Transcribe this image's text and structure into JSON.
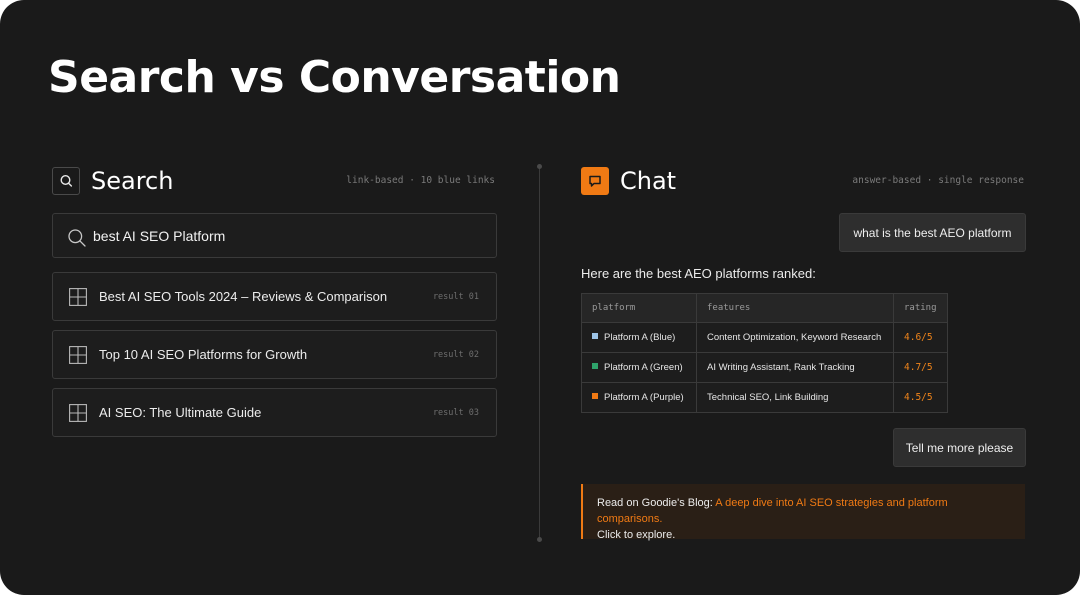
{
  "title": "Search vs Conversation",
  "search_panel": {
    "heading": "Search",
    "meta": "link-based · 10 blue links",
    "query": "best AI SEO Platform",
    "results": [
      {
        "title": "Best AI SEO Tools 2024 – Reviews & Comparison",
        "tag": "result 01"
      },
      {
        "title": "Top 10 AI SEO Platforms for Growth",
        "tag": "result 02"
      },
      {
        "title": "AI SEO: The Ultimate Guide",
        "tag": "result 03"
      }
    ]
  },
  "chat_panel": {
    "heading": "Chat",
    "meta": "answer-based · single response",
    "user_message": "what is the best AEO platform",
    "answer_intro": "Here are the best AEO platforms ranked:",
    "table": {
      "headers": [
        "platform",
        "features",
        "rating"
      ],
      "rows": [
        {
          "platform": "Platform A (Blue)",
          "features": "Content Optimization, Keyword Research",
          "rating": "4.6/5",
          "color": "#9cc3e6"
        },
        {
          "platform": "Platform A (Green)",
          "features": "AI Writing Assistant, Rank Tracking",
          "rating": "4.7/5",
          "color": "#2ea36b"
        },
        {
          "platform": "Platform A (Purple)",
          "features": "Technical SEO, Link Building",
          "rating": "4.5/5",
          "color": "#f07a14"
        }
      ]
    },
    "follow_up": "Tell me more please",
    "blog": {
      "prefix": "Read on Goodie's Blog: ",
      "link": "A deep dive into AI SEO strategies and platform comparisons.",
      "suffix": "Click to explore."
    }
  },
  "colors": {
    "background": "#1a1a1a",
    "accent": "#f07a14",
    "border": "#3a3a3a"
  },
  "icons": {
    "search_heading": "search-icon",
    "chat_heading": "chat-bubble-icon",
    "search_box": "search-icon",
    "result": "grid-icon"
  }
}
